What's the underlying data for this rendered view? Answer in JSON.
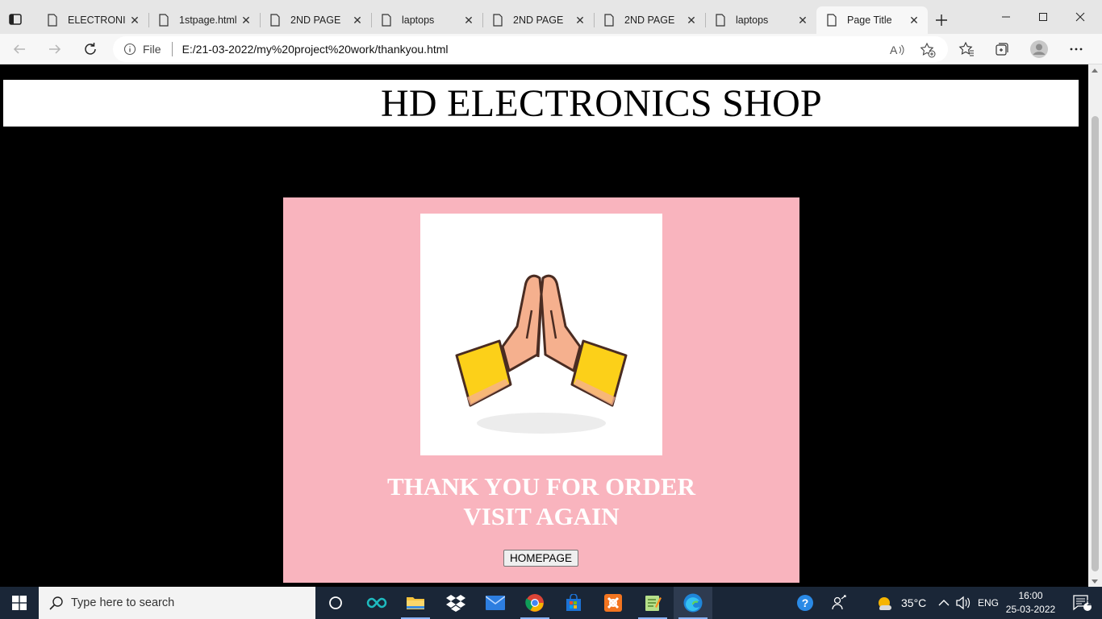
{
  "browser": {
    "tabs": [
      {
        "label": "ELECTRONIC",
        "active": false
      },
      {
        "label": "1stpage.html",
        "active": false
      },
      {
        "label": "2ND PAGE",
        "active": false
      },
      {
        "label": "laptops",
        "active": false
      },
      {
        "label": "2ND PAGE",
        "active": false
      },
      {
        "label": "2ND PAGE",
        "active": false
      },
      {
        "label": "laptops",
        "active": false
      },
      {
        "label": "Page Title",
        "active": true
      }
    ],
    "address": {
      "scheme_label": "File",
      "url": "E:/21-03-2022/my%20project%20work/thankyou.html"
    }
  },
  "page": {
    "site_title": "HD ELECTRONICS SHOP",
    "thank_line1": "THANK YOU FOR ORDER",
    "thank_line2": "VISIT AGAIN",
    "homepage_button": "HOMEPAGE"
  },
  "taskbar": {
    "search_placeholder": "Type here to search",
    "weather_temp": "35°C",
    "language": "ENG",
    "time": "16:00",
    "date": "25-03-2022",
    "notification_count": "1"
  },
  "colors": {
    "card_bg": "#f9b4be",
    "page_bg": "#000000",
    "taskbar_bg": "#1a2637"
  }
}
